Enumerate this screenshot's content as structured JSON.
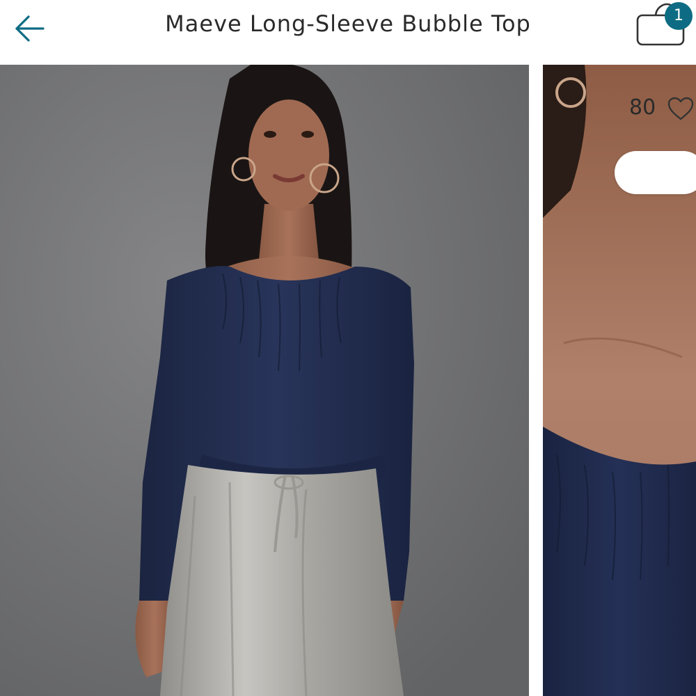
{
  "header": {
    "title": "Maeve Long-Sleeve Bubble Top",
    "back_icon": "arrow-left-icon",
    "cart_icon": "shopping-bag-icon",
    "cart_count": "1"
  },
  "gallery": {
    "favorites_count": "80",
    "favorite_icon": "heart-outline-icon"
  },
  "colors": {
    "accent": "#0d6c83",
    "title_text": "#2a2a2a",
    "top_navy": "#1f2a4a",
    "backdrop_gray": "#737375"
  }
}
